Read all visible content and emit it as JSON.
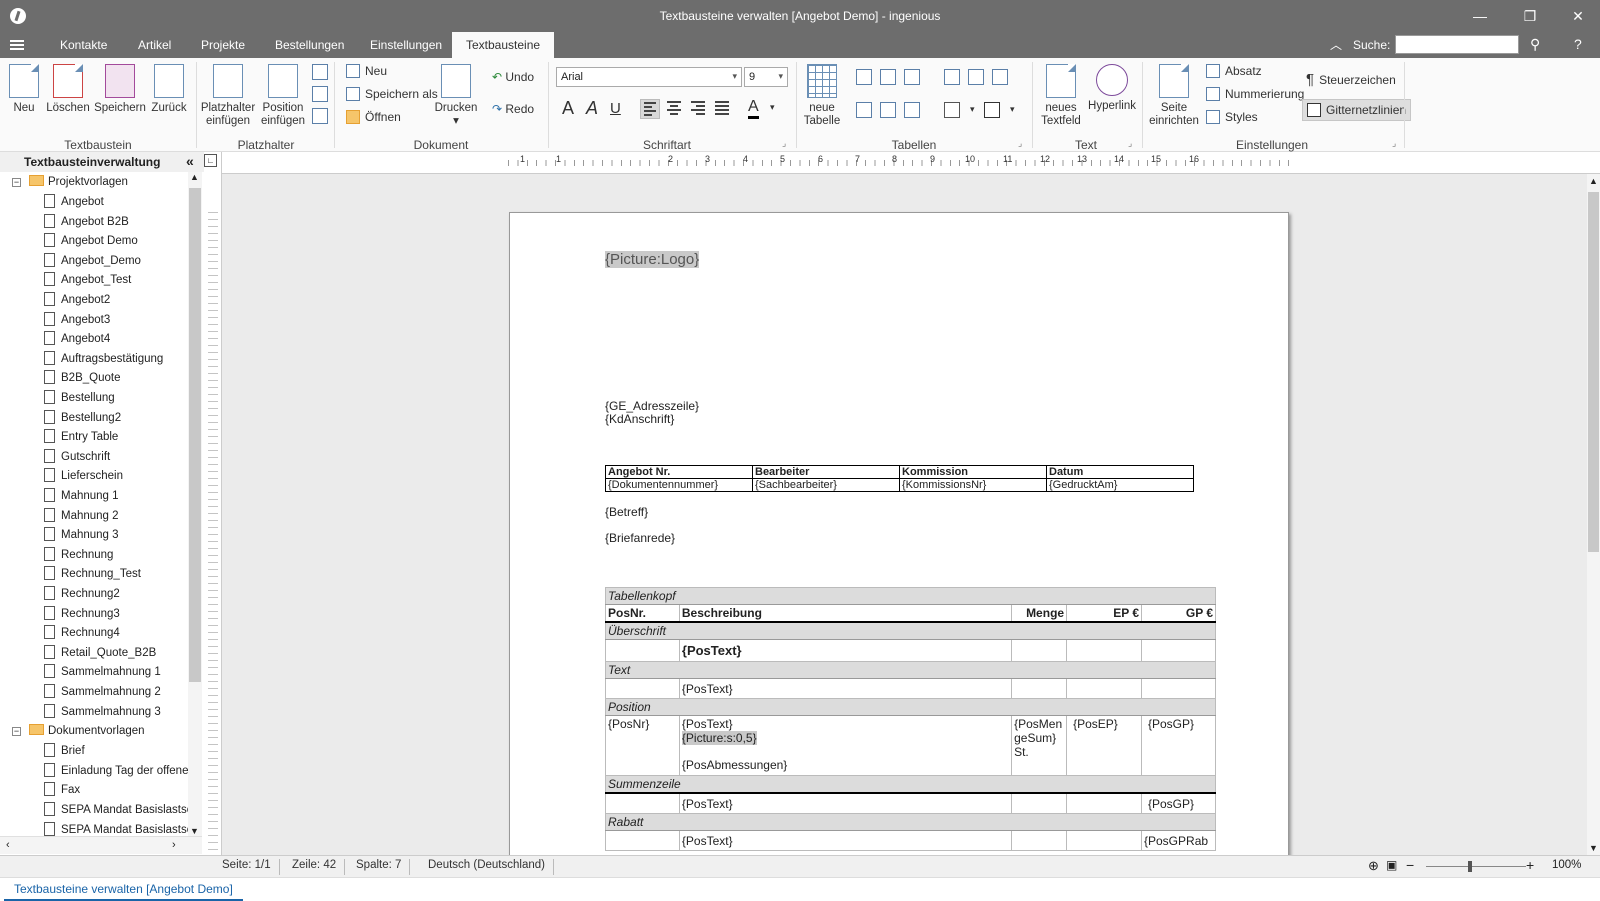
{
  "window": {
    "title": "Textbausteine verwalten [Angebot Demo] - ingenious"
  },
  "menu": {
    "tabs": [
      "Kontakte",
      "Artikel",
      "Projekte",
      "Bestellungen",
      "Einstellungen",
      "Textbausteine"
    ],
    "search_label": "Suche:",
    "search_value": ""
  },
  "ribbon": {
    "textbaustein": {
      "group": "Textbaustein",
      "neu": "Neu",
      "loeschen": "Löschen",
      "speichern": "Speichern",
      "zurueck": "Zurück"
    },
    "platzhalter": {
      "group": "Platzhalter",
      "einfuegen_l1": "Platzhalter",
      "einfuegen_l2": "einfügen",
      "position_l1": "Position",
      "position_l2": "einfügen"
    },
    "dokument": {
      "group": "Dokument",
      "neu": "Neu",
      "speichern_als": "Speichern als",
      "oeffnen": "Öffnen",
      "drucken": "Drucken",
      "undo": "Undo",
      "redo": "Redo"
    },
    "schriftart": {
      "group": "Schriftart",
      "font": "Arial",
      "size": "9"
    },
    "tabellen": {
      "group": "Tabellen",
      "neue_l1": "neue",
      "neue_l2": "Tabelle"
    },
    "text": {
      "group": "Text",
      "textfeld_l1": "neues",
      "textfeld_l2": "Textfeld",
      "hyperlink": "Hyperlink"
    },
    "einstellungen": {
      "group": "Einstellungen",
      "seite_l1": "Seite",
      "seite_l2": "einrichten",
      "absatz": "Absatz",
      "nummerierung": "Nummerierung",
      "styles": "Styles",
      "steuerzeichen": "Steuerzeichen",
      "gitternetzlinien": "Gitternetzlinien"
    }
  },
  "sidebar": {
    "title": "Textbausteinverwaltung",
    "folders": [
      {
        "name": "Projektvorlagen",
        "items": [
          "Angebot",
          "Angebot B2B",
          "Angebot Demo",
          "Angebot_Demo",
          "Angebot_Test",
          "Angebot2",
          "Angebot3",
          "Angebot4",
          "Auftragsbestätigung",
          "B2B_Quote",
          "Bestellung",
          "Bestellung2",
          "Entry Table",
          "Gutschrift",
          "Lieferschein",
          "Mahnung 1",
          "Mahnung 2",
          "Mahnung 3",
          "Rechnung",
          "Rechnung_Test",
          "Rechnung2",
          "Rechnung3",
          "Rechnung4",
          "Retail_Quote_B2B",
          "Sammelmahnung 1",
          "Sammelmahnung 2",
          "Sammelmahnung 3"
        ]
      },
      {
        "name": "Dokumentvorlagen",
        "items": [
          "Brief",
          "Einladung Tag der offenen",
          "Fax",
          "SEPA Mandat Basislastsch",
          "SEPA Mandat Basislastsch"
        ]
      }
    ]
  },
  "ruler": {
    "numbers": [
      "2",
      "1",
      "1",
      "2",
      "3",
      "4",
      "5",
      "6",
      "7",
      "8",
      "9",
      "10",
      "11",
      "12",
      "13",
      "14",
      "15",
      "16",
      "17",
      "18"
    ]
  },
  "document": {
    "logo": "{Picture:Logo}",
    "adresszeile": "{GE_Adresszeile}",
    "kdanschrift": "{KdAnschrift}",
    "info_header": [
      "Angebot Nr.",
      "Bearbeiter",
      "Kommission",
      "Datum"
    ],
    "info_values": [
      "{Dokumentennummer}",
      "{Sachbearbeiter}",
      "{KommissionsNr}",
      "{GedrucktAm}"
    ],
    "betreff": "{Betreff}",
    "briefanrede": "{Briefanrede}",
    "positions": {
      "tabellenkopf": "Tabellenkopf",
      "headers": [
        "PosNr.",
        "Beschreibung",
        "Menge",
        "EP €",
        "GP €"
      ],
      "ueberschrift": "Überschrift",
      "postext_bold": "{PosText}",
      "text_band": "Text",
      "postext": "{PosText}",
      "position_band": "Position",
      "posnr": "{PosNr}",
      "picture": "{Picture:s:0,5}",
      "posabmessungen": "{PosAbmessungen}",
      "menge_l1": "{PosMen",
      "menge_l2": "geSum}",
      "menge_l3": "St.",
      "posep": "{PosEP}",
      "posgp": "{PosGP}",
      "summenzeile": "Summenzeile",
      "rabatt": "Rabatt",
      "posgprab": "{PosGPRab"
    }
  },
  "status": {
    "seite": "Seite: 1/1",
    "zeile": "Zeile: 42",
    "spalte": "Spalte: 7",
    "sprache": "Deutsch (Deutschland)",
    "zoom": "100%"
  },
  "doc_tab": "Textbausteine verwalten [Angebot Demo]",
  "colors": {
    "chrome": "#6d6d6d",
    "accent": "#1a64a8",
    "folder": "#f6c56a"
  }
}
